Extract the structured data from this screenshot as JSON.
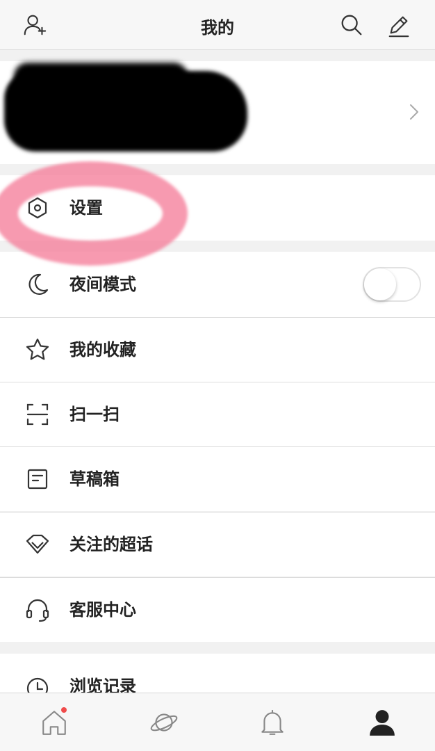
{
  "header": {
    "title": "我的"
  },
  "menu": {
    "settings": "设置",
    "night_mode": "夜间模式",
    "favorites": "我的收藏",
    "scan": "扫一扫",
    "drafts": "草稿箱",
    "super_topics": "关注的超话",
    "customer_service": "客服中心",
    "history": "浏览记录"
  },
  "night_mode_enabled": false,
  "colors": {
    "notification_dot": "#f04b4b",
    "annotation": "#f47896"
  }
}
